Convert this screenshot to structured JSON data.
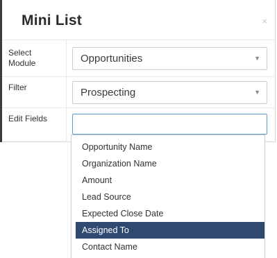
{
  "modal": {
    "title": "Mini List",
    "close_glyph": "×"
  },
  "form": {
    "module": {
      "label": "Select Module",
      "value": "Opportunities"
    },
    "filter": {
      "label": "Filter",
      "value": "Prospecting"
    },
    "edit_fields": {
      "label": "Edit Fields",
      "value": ""
    }
  },
  "dropdown": {
    "items": [
      "Opportunity Name",
      "Organization Name",
      "Amount",
      "Lead Source",
      "Expected Close Date",
      "Assigned To",
      "Contact Name"
    ],
    "highlighted": "Assigned To"
  },
  "colors": {
    "highlight_bg": "#2e4a70",
    "focus_border": "#5b9ad5"
  }
}
